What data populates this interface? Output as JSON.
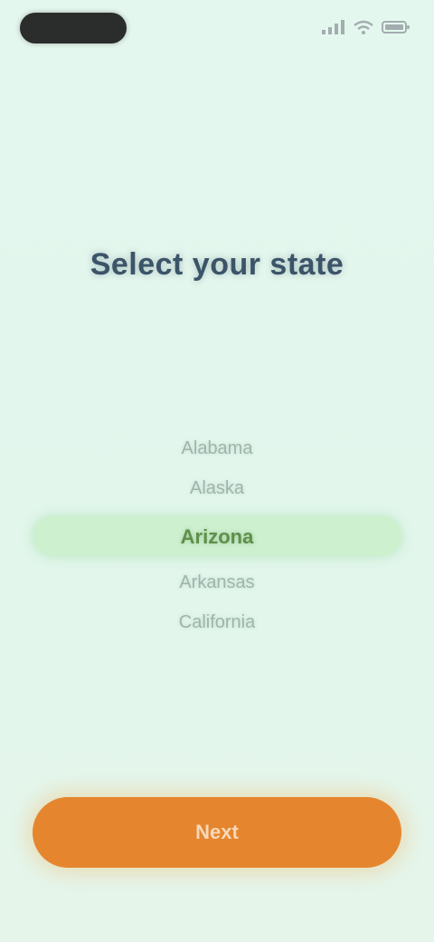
{
  "status_bar": {
    "pill_color": "#2a2d2b",
    "icons": [
      "signal-icon",
      "wifi-icon",
      "battery-icon"
    ]
  },
  "title": "Select your state",
  "picker": {
    "items": [
      "Alabama",
      "Alaska",
      "Arizona",
      "Arkansas",
      "California"
    ],
    "selected": "Arizona",
    "highlight_color": "#cdf0cf",
    "selected_color": "#5f8f4b"
  },
  "primary_button": {
    "label": "Next",
    "color": "#e5862f"
  }
}
